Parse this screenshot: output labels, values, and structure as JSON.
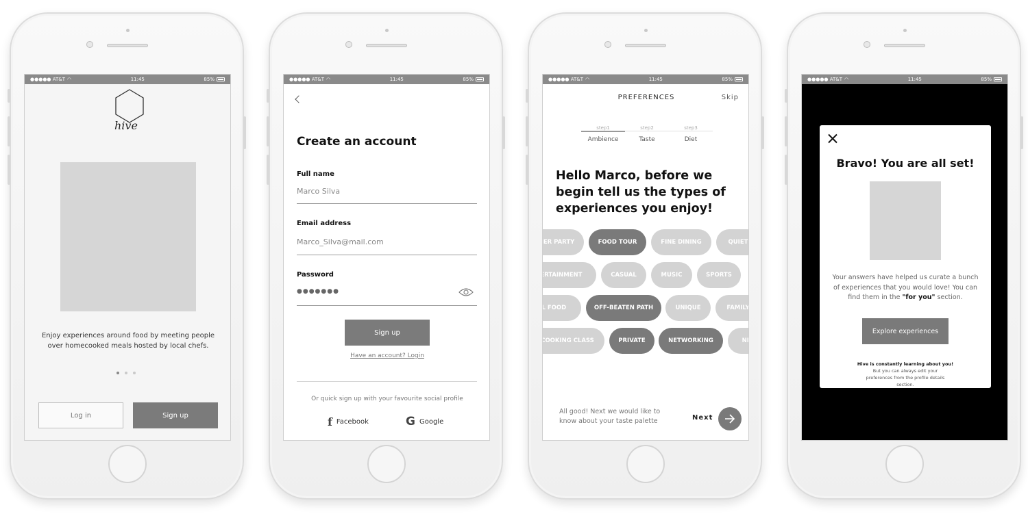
{
  "status_bar": {
    "carrier": "●●●●● AT&T",
    "time": "11:45",
    "battery": "85%"
  },
  "onboarding": {
    "logo_text": "hive",
    "description": "Enjoy experiences around food by meeting people over homecooked meals hosted by local chefs.",
    "login_label": "Log in",
    "signup_label": "Sign up"
  },
  "create_account": {
    "title": "Create an account",
    "full_name_label": "Full name",
    "full_name_value": "Marco Silva",
    "email_label": "Email address",
    "email_value": "Marco_Silva@mail.com",
    "password_label": "Password",
    "password_value": "●●●●●●●",
    "signup_label": "Sign up",
    "login_link": "Have an account? Login",
    "social_note": "Or quick sign up with your favourite social profile",
    "facebook_label": "Facebook",
    "google_label": "Google"
  },
  "preferences": {
    "title": "PREFERENCES",
    "skip_label": "Skip",
    "steps": [
      {
        "num": "step1",
        "label": "Ambience"
      },
      {
        "num": "step2",
        "label": "Taste"
      },
      {
        "num": "step3",
        "label": "Diet"
      }
    ],
    "greeting": "Hello Marco, before we begin tell us the types of experiences you enjoy!",
    "pills": [
      {
        "label": "NER PARTY",
        "selected": false
      },
      {
        "label": "FOOD TOUR",
        "selected": true
      },
      {
        "label": "FINE DINING",
        "selected": false
      },
      {
        "label": "QUIET",
        "selected": false
      },
      {
        "label": "TERTAINMENT",
        "selected": false
      },
      {
        "label": "CASUAL",
        "selected": false
      },
      {
        "label": "MUSIC",
        "selected": false
      },
      {
        "label": "SPORTS",
        "selected": false
      },
      {
        "label": "AL FOOD",
        "selected": false
      },
      {
        "label": "OFF-BEATEN PATH",
        "selected": true
      },
      {
        "label": "UNIQUE",
        "selected": false
      },
      {
        "label": "FAMILY",
        "selected": false
      },
      {
        "label": "COOKING CLASS",
        "selected": false
      },
      {
        "label": "PRIVATE",
        "selected": true
      },
      {
        "label": "NETWORKING",
        "selected": true
      },
      {
        "label": "NET",
        "selected": false
      }
    ],
    "footer_note": "All good! Next we would like to know about your taste palette",
    "next_label": "Next"
  },
  "success": {
    "title": "Bravo! You are all set!",
    "text_1": "Your answers have helped us curate a bunch of experiences that you would love! You can find them in the ",
    "text_highlight": "\"for you\"",
    "text_2": " section.",
    "button_label": "Explore experiences",
    "small_bold": "Hive is constantly learning about you!",
    "small_text": "But you can always edit your preferences from the profile details section."
  },
  "colors": {
    "accent_gray": "#7a7a7a",
    "placeholder_gray": "#d6d6d6",
    "overlay": "#000000"
  }
}
